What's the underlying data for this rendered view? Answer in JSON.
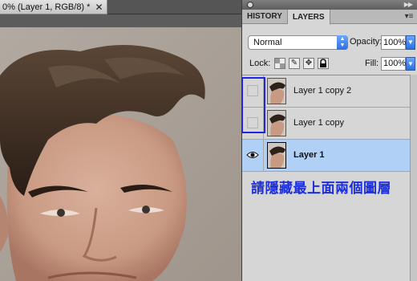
{
  "document": {
    "title": "0% (Layer 1, RGB/8) *",
    "close_glyph": "✕"
  },
  "panel": {
    "tabs": [
      {
        "label": "HISTORY",
        "active": false
      },
      {
        "label": "LAYERS",
        "active": true
      }
    ],
    "menu_glyph": "▾≡",
    "collapse_glyph": "▶▶",
    "blend_mode": "Normal",
    "opacity_label": "Opacity:",
    "opacity_value": "100%",
    "lock_label": "Lock:",
    "lock_icons": [
      "transparency-lock-icon",
      "brush-lock-icon",
      "move-lock-icon",
      "padlock-icon"
    ],
    "fill_label": "Fill:",
    "fill_value": "100%",
    "layers": [
      {
        "name": "Layer 1 copy 2",
        "visible": false,
        "selected": false
      },
      {
        "name": "Layer 1 copy",
        "visible": false,
        "selected": false
      },
      {
        "name": "Layer 1",
        "visible": true,
        "selected": true
      }
    ]
  },
  "annotation": {
    "instruction": "請隱藏最上面兩個圖層",
    "highlight_color": "#1f25e0",
    "text_color": "#1c2ed8"
  },
  "colors": {
    "selected_row": "#b1d0f5",
    "panel_bg": "#d6d6d6",
    "accent_blue": "#2c6fe0"
  }
}
